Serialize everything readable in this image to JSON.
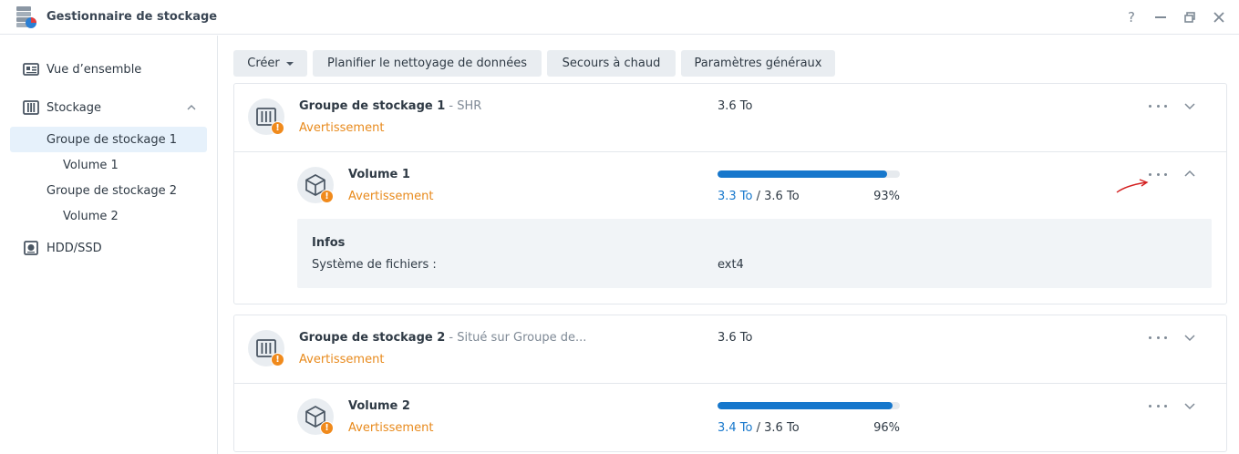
{
  "window": {
    "title": "Gestionnaire de stockage",
    "help": "?",
    "minimize": "—",
    "restore": "❐",
    "close": "✕"
  },
  "sidebar": {
    "items": [
      {
        "label": "Vue d’ensemble",
        "icon": "overview-icon"
      },
      {
        "label": "Stockage",
        "icon": "storage-icon",
        "expanded": true
      },
      {
        "label": "Groupe de stockage 1",
        "selected": true
      },
      {
        "label": "Volume 1"
      },
      {
        "label": "Groupe de stockage 2"
      },
      {
        "label": "Volume 2"
      },
      {
        "label": "HDD/SSD",
        "icon": "hdd-icon"
      }
    ]
  },
  "toolbar": {
    "create": "Créer",
    "schedule_scrub": "Planifier le nettoyage de données",
    "hot_spare": "Secours à chaud",
    "global_settings": "Paramètres généraux"
  },
  "pools": [
    {
      "title": "Groupe de stockage 1",
      "subtitle": " - SHR",
      "status": "Avertissement",
      "size": "3.6 To",
      "volume": {
        "name": "Volume 1",
        "status": "Avertissement",
        "used": "3.3 To",
        "sep": " / ",
        "total": "3.6 To",
        "percent": "93%",
        "fill": 0.93,
        "info": {
          "title": "Infos",
          "fs_label": "Système de fichiers :",
          "fs_value": "ext4"
        }
      }
    },
    {
      "title": "Groupe de stockage 2",
      "subtitle": " - Situé sur Groupe de...",
      "status": "Avertissement",
      "size": "3.6 To",
      "volume": {
        "name": "Volume 2",
        "status": "Avertissement",
        "used": "3.4 To",
        "sep": " / ",
        "total": "3.6 To",
        "percent": "96%",
        "fill": 0.96
      }
    }
  ],
  "colors": {
    "accent": "#1677cc",
    "warning": "#f08a1c",
    "annotation": "#d42020"
  },
  "warning_badge": "!"
}
